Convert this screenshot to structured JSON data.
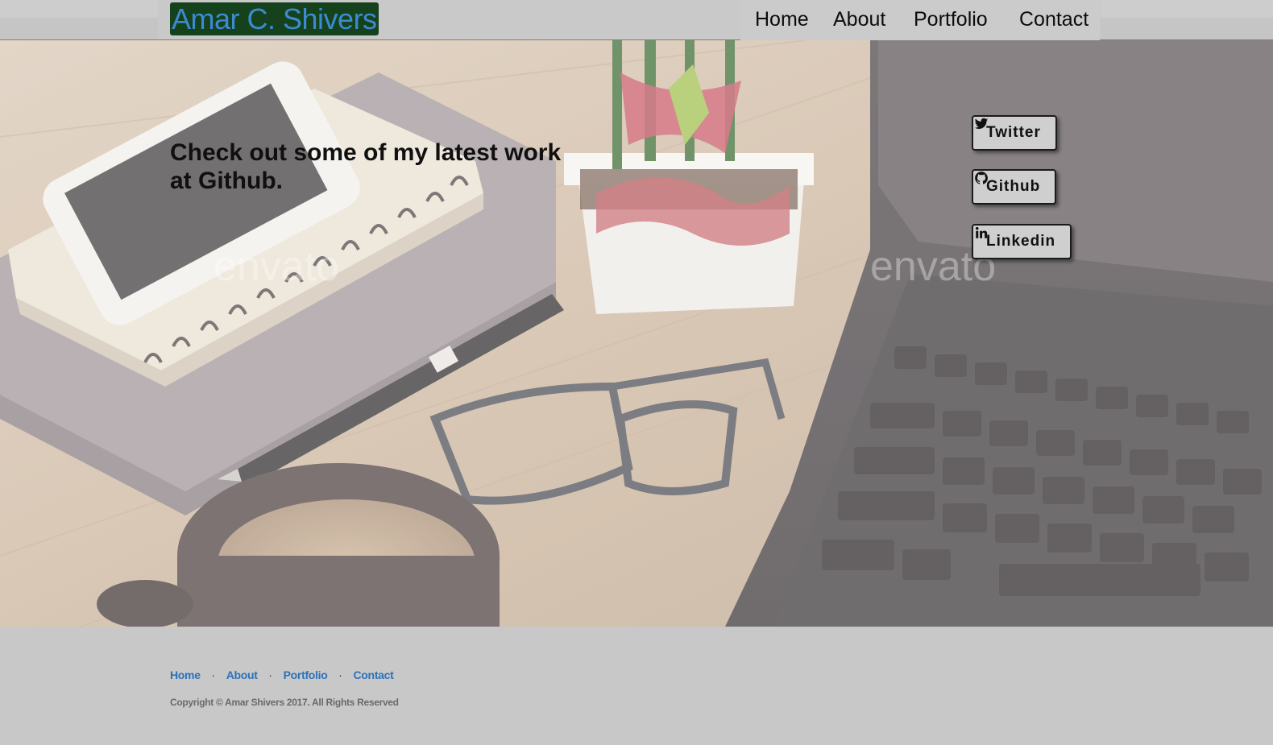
{
  "navbar": {
    "brand": "Amar C. Shivers",
    "links": [
      "Home",
      "About",
      "Portfolio",
      "Contact"
    ]
  },
  "hero": {
    "heading": "Check out some of my latest work at Github.",
    "watermark": "envato",
    "social_buttons": [
      {
        "label": "Twitter",
        "icon": "twitter-icon"
      },
      {
        "label": "Github",
        "icon": "github-icon"
      },
      {
        "label": "Linkedin",
        "icon": "linkedin-icon"
      }
    ]
  },
  "footer": {
    "links": [
      "Home",
      "About",
      "Portfolio",
      "Contact"
    ],
    "separator": "·",
    "copyright": "Copyright © Amar Shivers 2017. All Rights Reserved"
  },
  "colors": {
    "brand_bg": "#15421c",
    "brand_text": "#3c8ad0",
    "link": "#2d71b8",
    "page_bg": "#c8c8c8"
  }
}
